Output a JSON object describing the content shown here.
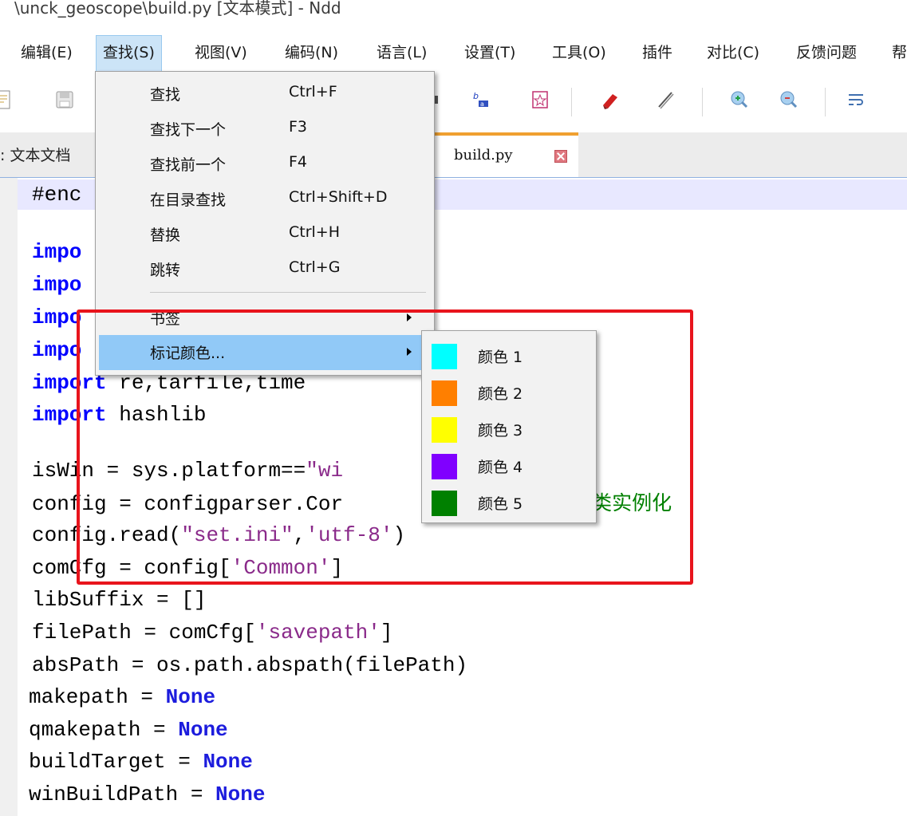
{
  "window": {
    "title": "\\unck_geoscope\\build.py [文本模式] - Ndd"
  },
  "menubar": {
    "items": [
      "编辑(E)",
      "查找(S)",
      "视图(V)",
      "编码(N)",
      "语言(L)",
      "设置(T)",
      "工具(O)",
      "插件",
      "对比(C)",
      "反馈问题",
      "帮"
    ]
  },
  "tabs": {
    "left": "文本文档",
    "active": "build.py"
  },
  "editor": {
    "lines": [
      {
        "parts": [
          {
            "t": "#enc",
            "c": "plain"
          }
        ]
      },
      {
        "parts": [
          {
            "t": "impo",
            "c": "kw"
          }
        ]
      },
      {
        "parts": [
          {
            "t": "impo",
            "c": "kw"
          }
        ]
      },
      {
        "parts": [
          {
            "t": "impo",
            "c": "kw"
          }
        ]
      },
      {
        "parts": [
          {
            "t": "impo",
            "c": "kw"
          }
        ]
      },
      {
        "parts": [
          {
            "t": "import",
            "c": "kw"
          },
          {
            "t": " re,tarfile,time",
            "c": "plain"
          }
        ]
      },
      {
        "parts": [
          {
            "t": "import",
            "c": "kw"
          },
          {
            "t": " hashlib",
            "c": "plain"
          }
        ]
      },
      {
        "parts": [
          {
            "t": "isWin = sys.platform==",
            "c": "plain"
          },
          {
            "t": "\"wi",
            "c": "str"
          }
        ]
      },
      {
        "parts": [
          {
            "t": "config = configparser.Cor",
            "c": "plain"
          },
          {
            "t": "                  # ",
            "c": "cmt"
          },
          {
            "t": "类实例化",
            "c": "cmtcn"
          }
        ]
      },
      {
        "parts": [
          {
            "t": "config.read(",
            "c": "plain"
          },
          {
            "t": "\"set.ini\"",
            "c": "str"
          },
          {
            "t": ",",
            "c": "plain"
          },
          {
            "t": "'utf-8'",
            "c": "str"
          },
          {
            "t": ")",
            "c": "plain"
          }
        ]
      },
      {
        "parts": [
          {
            "t": "comCfg = config[",
            "c": "plain"
          },
          {
            "t": "'Common'",
            "c": "str"
          },
          {
            "t": "]",
            "c": "plain"
          }
        ]
      },
      {
        "parts": [
          {
            "t": "libSuffix = []",
            "c": "plain"
          }
        ]
      },
      {
        "parts": [
          {
            "t": "filePath = comCfg[",
            "c": "plain"
          },
          {
            "t": "'savepath'",
            "c": "str"
          },
          {
            "t": "]",
            "c": "plain"
          }
        ]
      },
      {
        "parts": [
          {
            "t": "absPath = os.path.abspath(filePath)",
            "c": "plain"
          }
        ]
      },
      {
        "parts": [
          {
            "t": "makepath = ",
            "c": "plain"
          },
          {
            "t": "None",
            "c": "kw2"
          }
        ]
      },
      {
        "parts": [
          {
            "t": "qmakepath = ",
            "c": "plain"
          },
          {
            "t": "None",
            "c": "kw2"
          }
        ]
      },
      {
        "parts": [
          {
            "t": "buildTarget = ",
            "c": "plain"
          },
          {
            "t": "None",
            "c": "kw2"
          }
        ]
      },
      {
        "parts": [
          {
            "t": "winBuildPath = ",
            "c": "plain"
          },
          {
            "t": "None",
            "c": "kw2"
          }
        ]
      }
    ]
  },
  "find_menu": {
    "items": [
      {
        "label": "查找",
        "shortcut": "Ctrl+F"
      },
      {
        "label": "查找下一个",
        "shortcut": "F3"
      },
      {
        "label": "查找前一个",
        "shortcut": "F4"
      },
      {
        "label": "在目录查找",
        "shortcut": "Ctrl+Shift+D"
      },
      {
        "label": "替换",
        "shortcut": "Ctrl+H"
      },
      {
        "label": "跳转",
        "shortcut": "Ctrl+G"
      }
    ],
    "bookmark": "书签",
    "mark_color": "标记颜色..."
  },
  "color_submenu": {
    "items": [
      {
        "label": "颜色 1",
        "color": "#00ffff"
      },
      {
        "label": "颜色 2",
        "color": "#ff7f00"
      },
      {
        "label": "颜色 3",
        "color": "#ffff00"
      },
      {
        "label": "颜色 4",
        "color": "#8000ff"
      },
      {
        "label": "颜色 5",
        "color": "#008000"
      }
    ]
  },
  "colors": {
    "highlight": "#91c9f7",
    "annotation_box": "#e8141c",
    "tab_accent": "#f0a030"
  }
}
